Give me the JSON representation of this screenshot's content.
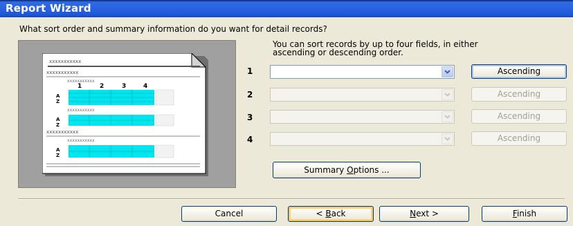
{
  "window": {
    "title": "Report Wizard"
  },
  "question": "What sort order and summary information do you want for detail records?",
  "intro": [
    "You can sort records by up to four fields, in either",
    "ascending or descending order."
  ],
  "preview": {
    "label_text": "xxxxxxxxxxx",
    "column_numbers": [
      "1",
      "2",
      "3",
      "4"
    ],
    "sort_glyph_top": "A",
    "sort_glyph_bottom": "Z",
    "cell_color": "#00e5ee"
  },
  "sort_fields": [
    {
      "number": "1",
      "value": "",
      "enabled": true,
      "order_label": "Ascending"
    },
    {
      "number": "2",
      "value": "",
      "enabled": false,
      "order_label": "Ascending"
    },
    {
      "number": "3",
      "value": "",
      "enabled": false,
      "order_label": "Ascending"
    },
    {
      "number": "4",
      "value": "",
      "enabled": false,
      "order_label": "Ascending"
    }
  ],
  "summary_options": {
    "before": "Summary ",
    "mnemonic": "O",
    "after": "ptions ..."
  },
  "buttons": {
    "cancel": {
      "label": "Cancel"
    },
    "back": {
      "prefix": "< ",
      "mnemonic": "B",
      "after": "ack"
    },
    "next": {
      "mnemonic": "N",
      "after": "ext >"
    },
    "finish": {
      "mnemonic": "F",
      "after": "inish"
    }
  },
  "colors": {
    "title_bar": "#2a63e0",
    "dialog_bg": "#ece9d8",
    "preview_bg": "#a0a0a0",
    "accent_cells": "#00e5ee"
  }
}
